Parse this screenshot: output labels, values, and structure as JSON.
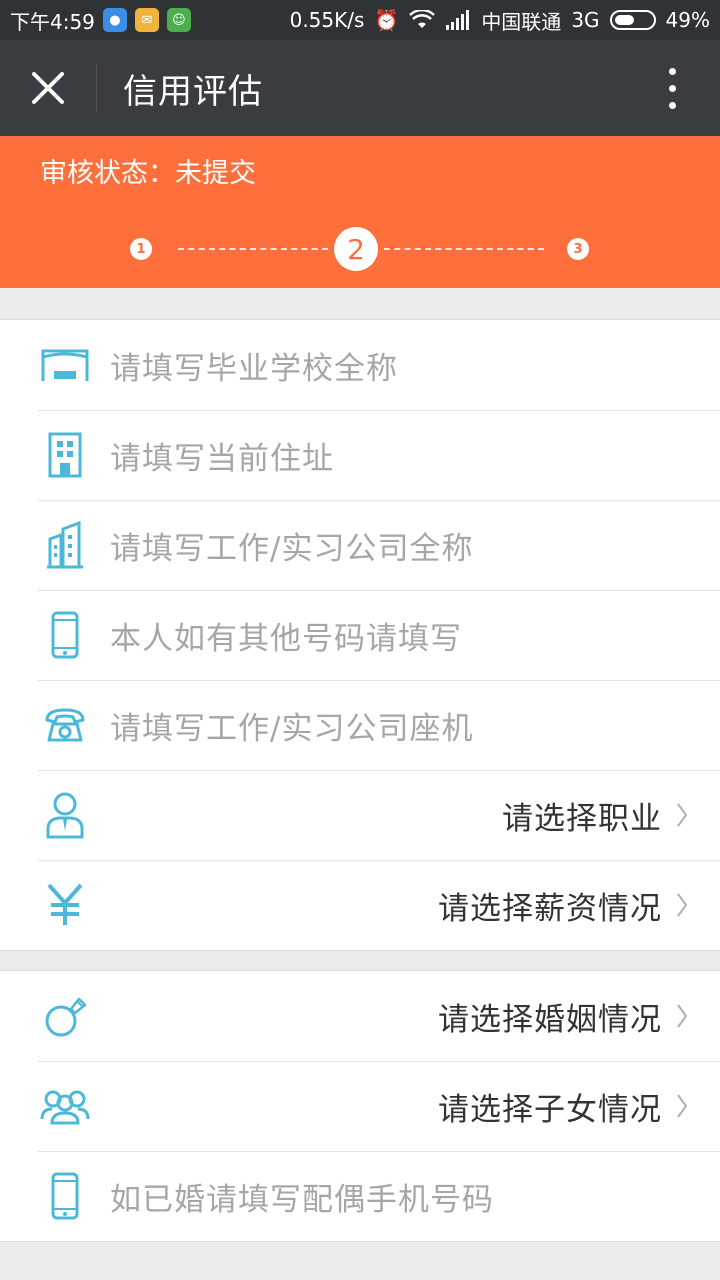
{
  "status_bar": {
    "time": "下午4:59",
    "speed": "0.55K/s",
    "carrier": "中国联通",
    "network": "3G",
    "battery": "49%"
  },
  "nav": {
    "title": "信用评估"
  },
  "audit_status": "审核状态：未提交",
  "steps": [
    "1",
    "2",
    "3"
  ],
  "form_group_1": [
    {
      "icon": "school-icon",
      "placeholder": "请填写毕业学校全称"
    },
    {
      "icon": "building-icon",
      "placeholder": "请填写当前住址"
    },
    {
      "icon": "company-icon",
      "placeholder": "请填写工作/实习公司全称"
    },
    {
      "icon": "phone-icon",
      "placeholder": "本人如有其他号码请填写"
    },
    {
      "icon": "telephone-icon",
      "placeholder": "请填写工作/实习公司座机"
    },
    {
      "icon": "user-icon",
      "select": "请选择职业"
    },
    {
      "icon": "yuan-icon",
      "select": "请选择薪资情况"
    }
  ],
  "form_group_2": [
    {
      "icon": "ring-icon",
      "select": "请选择婚姻情况"
    },
    {
      "icon": "family-icon",
      "select": "请选择子女情况"
    },
    {
      "icon": "phone-icon",
      "placeholder": "如已婚请填写配偶手机号码"
    }
  ],
  "colors": {
    "accent": "#ff6f3c",
    "icon": "#4cb8d9",
    "navbar": "#3a3d40"
  }
}
